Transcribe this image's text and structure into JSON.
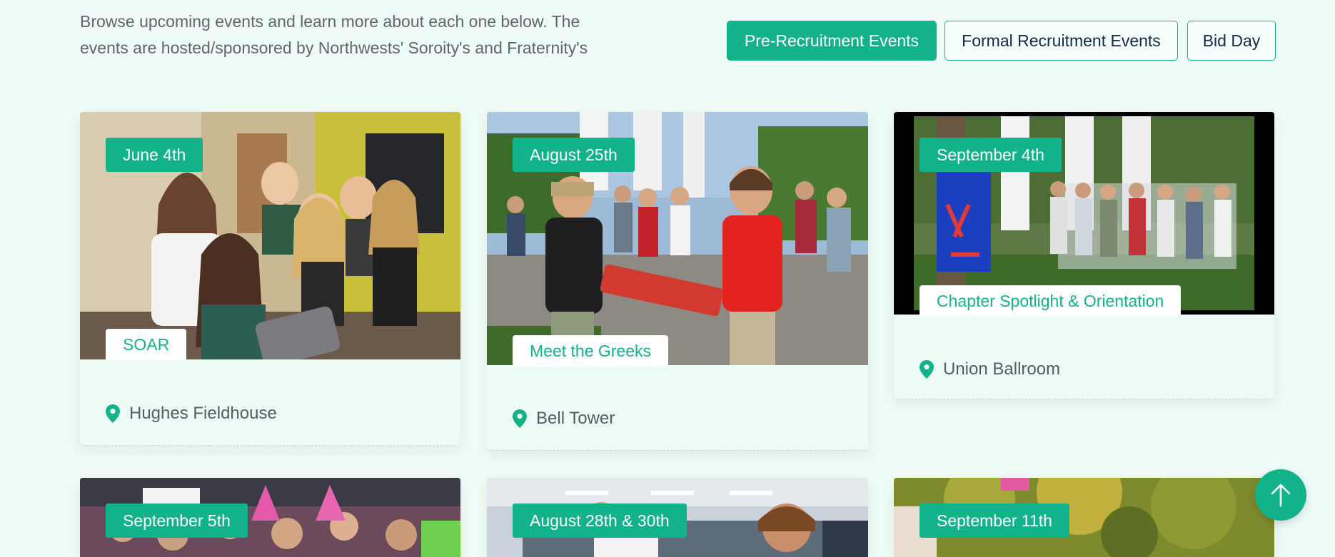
{
  "intro": {
    "line1": "Browse upcoming events and learn more about each one below. The",
    "line2": "events are hosted/sponsored by Northwests' Soroity's and Fraternity's"
  },
  "filters": [
    {
      "label": "Pre-Recruitment Events",
      "active": true
    },
    {
      "label": "Formal Recruitment Events",
      "active": false
    },
    {
      "label": "Bid Day",
      "active": false
    }
  ],
  "events": [
    {
      "date": "June 4th",
      "title": "SOAR",
      "location": "Hughes Fieldhouse",
      "photo": "group-selfie-photo"
    },
    {
      "date": "August 25th",
      "title": "Meet the Greeks",
      "location": "Bell Tower",
      "photo": "bell-tower-crowd-photo"
    },
    {
      "date": "September 4th",
      "title": "Chapter Spotlight & Orientation",
      "location": "Union Ballroom",
      "photo": "chapter-banner-photo"
    },
    {
      "date": "September 5th",
      "photo": "cheering-crowd-photo"
    },
    {
      "date": "August 28th & 30th",
      "photo": "classroom-event-photo"
    },
    {
      "date": "September 11th",
      "photo": "outdoor-trees-photo"
    }
  ],
  "icons": {
    "location": "map-pin-icon",
    "scroll_top": "arrow-up-icon"
  },
  "colors": {
    "accent": "#12b38a",
    "background": "#effbf6",
    "card": "#ecfbf3",
    "navy": "#14284b"
  }
}
